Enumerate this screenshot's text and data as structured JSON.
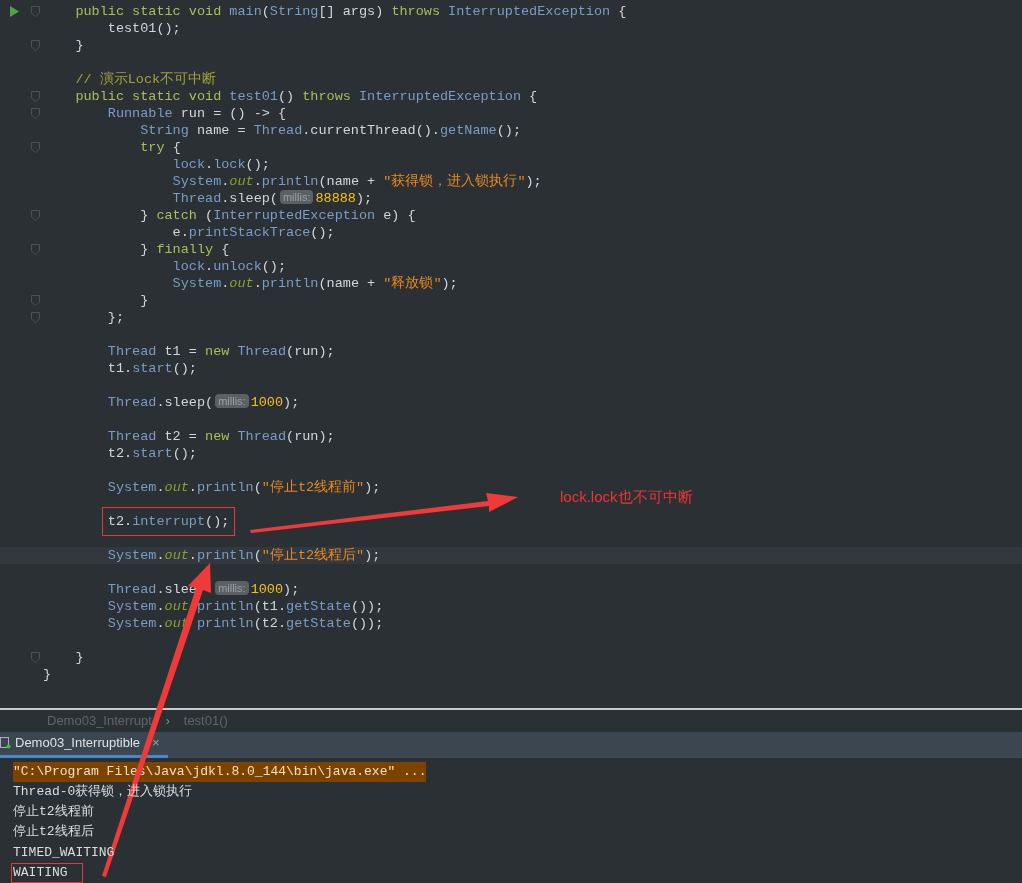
{
  "editor": {
    "lines": [
      {
        "run": true,
        "fold": true,
        "tokens": [
          {
            "kind": "kw",
            "text": "    public static void "
          },
          {
            "kind": "type",
            "text": "main"
          },
          {
            "kind": "plain",
            "text": "("
          },
          {
            "kind": "type",
            "text": "String"
          },
          {
            "kind": "plain",
            "text": "[] args) "
          },
          {
            "kind": "kw",
            "text": "throws "
          },
          {
            "kind": "type",
            "text": "InterruptedException"
          },
          {
            "kind": "plain",
            "text": " {"
          }
        ]
      },
      {
        "tokens": [
          {
            "kind": "plain",
            "text": "        test01();"
          }
        ]
      },
      {
        "fold": true,
        "tokens": [
          {
            "kind": "plain",
            "text": "    }"
          }
        ]
      },
      {
        "space_before": true,
        "tokens": [
          {
            "kind": "comment",
            "text": "    // 演示Lock不可中断"
          }
        ]
      },
      {
        "fold": true,
        "tokens": [
          {
            "kind": "kw",
            "text": "    public static void "
          },
          {
            "kind": "type",
            "text": "test01"
          },
          {
            "kind": "plain",
            "text": "() "
          },
          {
            "kind": "kw",
            "text": "throws "
          },
          {
            "kind": "type",
            "text": "InterruptedException"
          },
          {
            "kind": "plain",
            "text": " {"
          }
        ]
      },
      {
        "fold": true,
        "tokens": [
          {
            "kind": "type",
            "text": "        Runnable"
          },
          {
            "kind": "plain",
            "text": " run = () -> {"
          }
        ]
      },
      {
        "tokens": [
          {
            "kind": "type",
            "text": "            String"
          },
          {
            "kind": "plain",
            "text": " name = "
          },
          {
            "kind": "type",
            "text": "Thread"
          },
          {
            "kind": "plain",
            "text": ".currentThread()."
          },
          {
            "kind": "type",
            "text": "getName"
          },
          {
            "kind": "plain",
            "text": "();"
          }
        ]
      },
      {
        "fold": true,
        "tokens": [
          {
            "kind": "kw",
            "text": "            try"
          },
          {
            "kind": "plain",
            "text": " {"
          }
        ]
      },
      {
        "tokens": [
          {
            "kind": "type",
            "text": "                lock"
          },
          {
            "kind": "plain",
            "text": "."
          },
          {
            "kind": "type",
            "text": "lock"
          },
          {
            "kind": "plain",
            "text": "();"
          }
        ]
      },
      {
        "tokens": [
          {
            "kind": "type",
            "text": "                System"
          },
          {
            "kind": "plain",
            "text": "."
          },
          {
            "kind": "field",
            "text": "out"
          },
          {
            "kind": "plain",
            "text": "."
          },
          {
            "kind": "type",
            "text": "println"
          },
          {
            "kind": "plain",
            "text": "(name + "
          },
          {
            "kind": "str",
            "text": "\"获得锁，进入锁执行\""
          },
          {
            "kind": "plain",
            "text": ");"
          }
        ]
      },
      {
        "tokens": [
          {
            "kind": "type",
            "text": "                Thread"
          },
          {
            "kind": "plain",
            "text": ".sleep("
          },
          {
            "kind": "hint",
            "text": "millis:"
          },
          {
            "kind": "num",
            "text": "88888"
          },
          {
            "kind": "plain",
            "text": ");"
          }
        ]
      },
      {
        "fold": true,
        "tokens": [
          {
            "kind": "plain",
            "text": "            } "
          },
          {
            "kind": "kw",
            "text": "catch"
          },
          {
            "kind": "plain",
            "text": " ("
          },
          {
            "kind": "type",
            "text": "InterruptedException"
          },
          {
            "kind": "plain",
            "text": " e) {"
          }
        ]
      },
      {
        "tokens": [
          {
            "kind": "plain",
            "text": "                e."
          },
          {
            "kind": "type",
            "text": "printStackTrace"
          },
          {
            "kind": "plain",
            "text": "();"
          }
        ]
      },
      {
        "fold": true,
        "tokens": [
          {
            "kind": "plain",
            "text": "            } "
          },
          {
            "kind": "kw",
            "text": "finally"
          },
          {
            "kind": "plain",
            "text": " {"
          }
        ]
      },
      {
        "tokens": [
          {
            "kind": "type",
            "text": "                lock"
          },
          {
            "kind": "plain",
            "text": "."
          },
          {
            "kind": "type",
            "text": "unlock"
          },
          {
            "kind": "plain",
            "text": "();"
          }
        ]
      },
      {
        "tokens": [
          {
            "kind": "type",
            "text": "                System"
          },
          {
            "kind": "plain",
            "text": "."
          },
          {
            "kind": "field",
            "text": "out"
          },
          {
            "kind": "plain",
            "text": "."
          },
          {
            "kind": "type",
            "text": "println"
          },
          {
            "kind": "plain",
            "text": "(name + "
          },
          {
            "kind": "str",
            "text": "\"释放锁\""
          },
          {
            "kind": "plain",
            "text": ");"
          }
        ]
      },
      {
        "fold": true,
        "tokens": [
          {
            "kind": "plain",
            "text": "            }"
          }
        ]
      },
      {
        "fold": true,
        "tokens": [
          {
            "kind": "plain",
            "text": "        };"
          }
        ]
      },
      {
        "space_before": true,
        "tokens": [
          {
            "kind": "type",
            "text": "        Thread"
          },
          {
            "kind": "plain",
            "text": " t1 = "
          },
          {
            "kind": "kw",
            "text": "new "
          },
          {
            "kind": "type",
            "text": "Thread"
          },
          {
            "kind": "plain",
            "text": "(run);"
          }
        ]
      },
      {
        "tokens": [
          {
            "kind": "plain",
            "text": "        t1."
          },
          {
            "kind": "type",
            "text": "start"
          },
          {
            "kind": "plain",
            "text": "();"
          }
        ]
      },
      {
        "space_before": true,
        "tokens": [
          {
            "kind": "type",
            "text": "        Thread"
          },
          {
            "kind": "plain",
            "text": ".sleep("
          },
          {
            "kind": "hint",
            "text": "millis:"
          },
          {
            "kind": "num",
            "text": "1000"
          },
          {
            "kind": "plain",
            "text": ");"
          }
        ]
      },
      {
        "space_before": true,
        "tokens": [
          {
            "kind": "type",
            "text": "        Thread"
          },
          {
            "kind": "plain",
            "text": " t2 = "
          },
          {
            "kind": "kw",
            "text": "new "
          },
          {
            "kind": "type",
            "text": "Thread"
          },
          {
            "kind": "plain",
            "text": "(run);"
          }
        ]
      },
      {
        "tokens": [
          {
            "kind": "plain",
            "text": "        t2."
          },
          {
            "kind": "type",
            "text": "start"
          },
          {
            "kind": "plain",
            "text": "();"
          }
        ]
      },
      {
        "space_before": true,
        "tokens": [
          {
            "kind": "type",
            "text": "        System"
          },
          {
            "kind": "plain",
            "text": "."
          },
          {
            "kind": "field",
            "text": "out"
          },
          {
            "kind": "plain",
            "text": "."
          },
          {
            "kind": "type",
            "text": "println"
          },
          {
            "kind": "plain",
            "text": "("
          },
          {
            "kind": "str",
            "text": "\"停止t2线程前\""
          },
          {
            "kind": "plain",
            "text": ");"
          }
        ]
      },
      {
        "space_before": true,
        "boxed": true,
        "tokens": [
          {
            "kind": "plain",
            "text": "        t2."
          },
          {
            "kind": "type",
            "text": "interrupt"
          },
          {
            "kind": "plain",
            "text": "();"
          }
        ]
      },
      {
        "space_before": true,
        "current": true,
        "tokens": [
          {
            "kind": "type",
            "text": "        System"
          },
          {
            "kind": "plain",
            "text": "."
          },
          {
            "kind": "field",
            "text": "out"
          },
          {
            "kind": "plain",
            "text": "."
          },
          {
            "kind": "type",
            "text": "println"
          },
          {
            "kind": "plain",
            "text": "("
          },
          {
            "kind": "str",
            "text": "\"停止t2线程后\""
          },
          {
            "kind": "plain",
            "text": ");"
          }
        ]
      },
      {
        "space_before": true,
        "tokens": [
          {
            "kind": "type",
            "text": "        Thread"
          },
          {
            "kind": "plain",
            "text": ".slee"
          },
          {
            "kind": "gap"
          },
          {
            "kind": "gap"
          },
          {
            "kind": "hint",
            "text": "millis:"
          },
          {
            "kind": "num",
            "text": "1000"
          },
          {
            "kind": "plain",
            "text": ");"
          }
        ]
      },
      {
        "tokens": [
          {
            "kind": "type",
            "text": "        System"
          },
          {
            "kind": "plain",
            "text": "."
          },
          {
            "kind": "field",
            "text": "out"
          },
          {
            "kind": "gap"
          },
          {
            "kind": "type",
            "text": "println"
          },
          {
            "kind": "plain",
            "text": "(t1."
          },
          {
            "kind": "type",
            "text": "getState"
          },
          {
            "kind": "plain",
            "text": "());"
          }
        ]
      },
      {
        "tokens": [
          {
            "kind": "type",
            "text": "        System"
          },
          {
            "kind": "plain",
            "text": "."
          },
          {
            "kind": "field",
            "text": "out"
          },
          {
            "kind": "gap"
          },
          {
            "kind": "type",
            "text": "println"
          },
          {
            "kind": "plain",
            "text": "(t2."
          },
          {
            "kind": "type",
            "text": "getState"
          },
          {
            "kind": "plain",
            "text": "());"
          }
        ]
      },
      {
        "space_before": true,
        "fold": true,
        "tokens": [
          {
            "kind": "plain",
            "text": "    }"
          }
        ]
      },
      {
        "tokens": [
          {
            "kind": "plain",
            "text": "}"
          }
        ]
      }
    ]
  },
  "breadcrumb": {
    "items": [
      "Demo03_Interrupt",
      "test01()"
    ],
    "separator": "›"
  },
  "run_tab": {
    "label": "Demo03_Interruptible",
    "close": "×",
    "selected": true
  },
  "console": [
    {
      "kind": "command",
      "text": "\"C:\\Program Files\\Java\\jdkl.8.0_144\\bin\\java.exe\" ..."
    },
    {
      "kind": "output",
      "text": "Thread-0获得锁，进入锁执行"
    },
    {
      "kind": "output",
      "text": "停止t2线程前"
    },
    {
      "kind": "output",
      "text": "停止t2线程后"
    },
    {
      "kind": "output",
      "text": "TIMED_WAITING"
    },
    {
      "kind": "output",
      "text": "WAITING",
      "boxed": true
    }
  ],
  "annotation": {
    "text": "lock.lock也不可中断"
  }
}
